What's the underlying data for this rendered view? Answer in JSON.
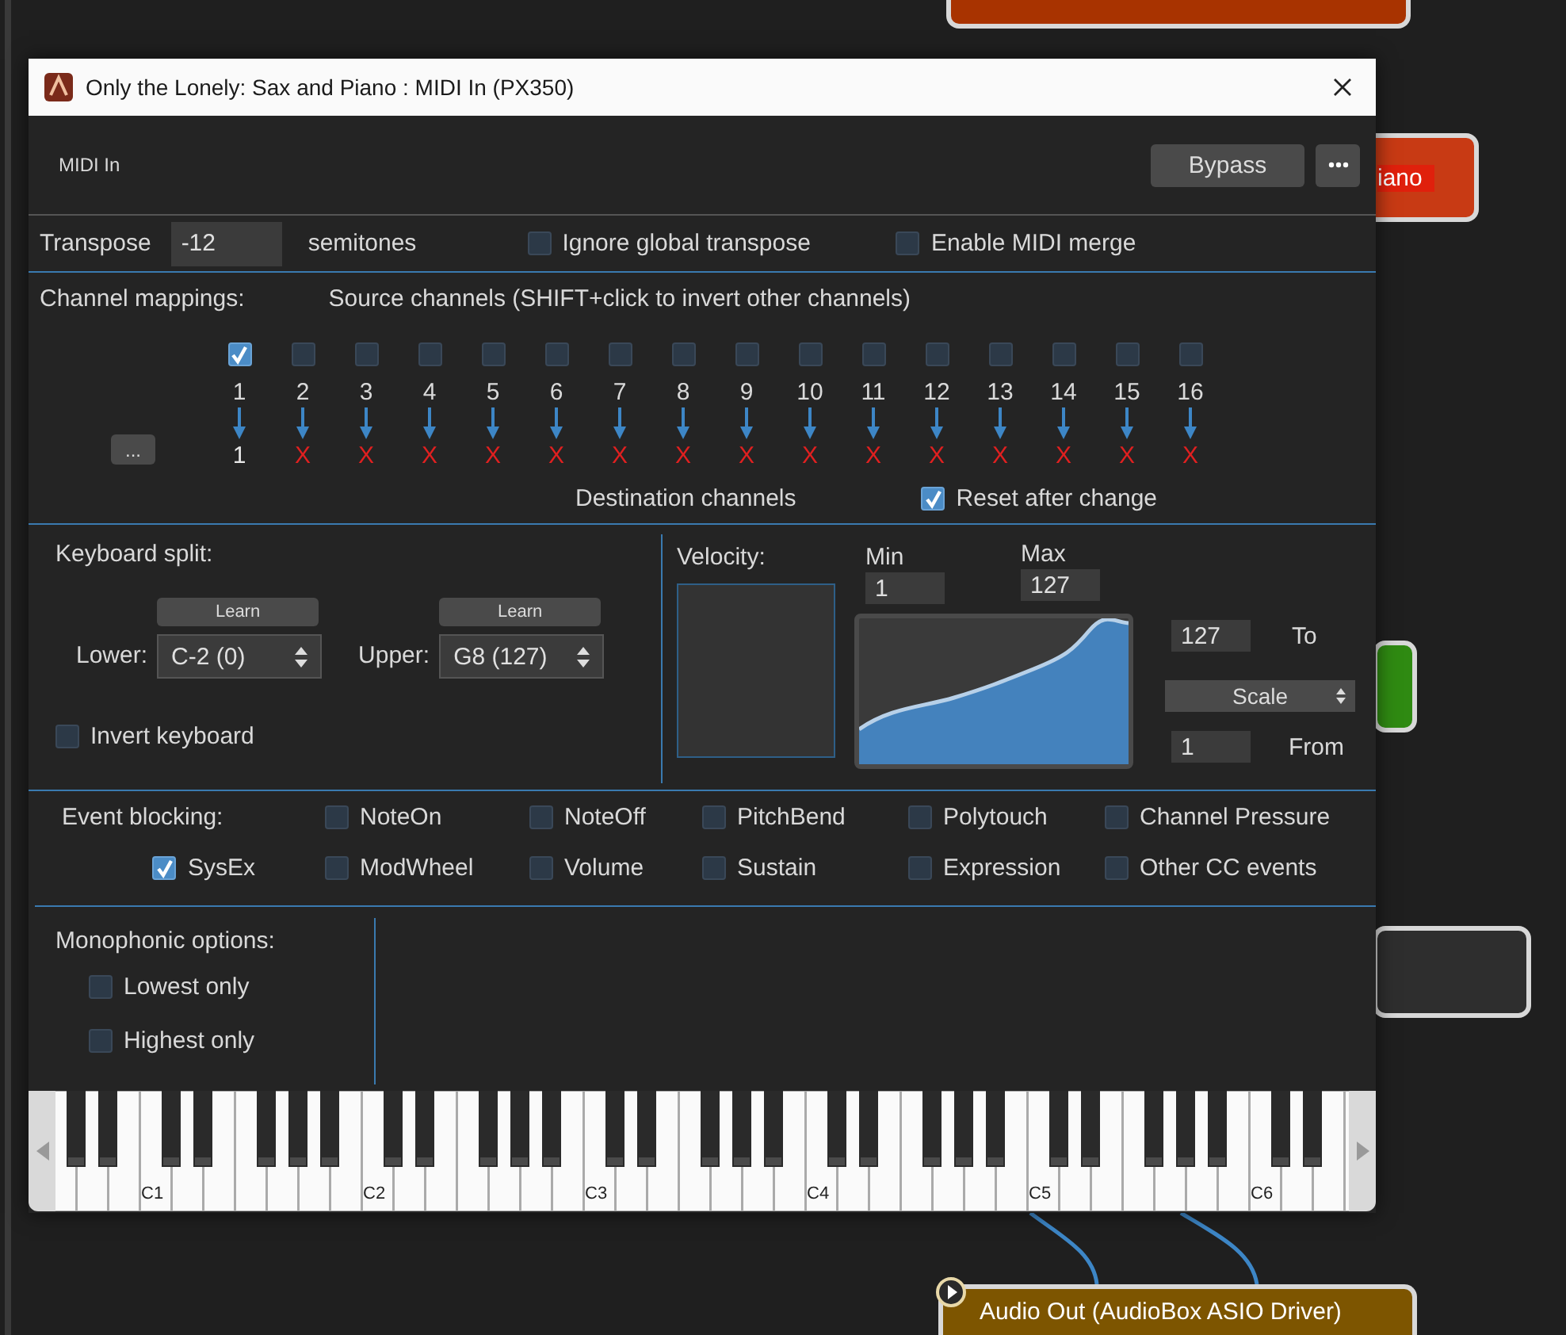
{
  "canvas": {
    "nodes": [
      {
        "color": "#a83300"
      },
      {
        "color": "#c83a14",
        "label": "iano"
      },
      {
        "color": "#2f8a12"
      },
      {
        "color": "#2e2e2e"
      },
      {
        "color": "#7d5500",
        "label": "Audio Out (AudioBox ASIO Driver)"
      }
    ]
  },
  "window": {
    "title": "Only the Lonely: Sax and Piano : MIDI In (PX350)"
  },
  "header": {
    "label": "MIDI In",
    "bypass": "Bypass"
  },
  "transpose": {
    "label": "Transpose",
    "value": "-12",
    "unit": "semitones",
    "options": [
      {
        "label": "Ignore global transpose",
        "checked": false
      },
      {
        "label": "Enable MIDI merge",
        "checked": false
      }
    ]
  },
  "channel_mappings": {
    "label": "Channel mappings:",
    "source_heading": "Source channels (SHIFT+click to invert other channels)",
    "more_button": "...",
    "destination_heading": "Destination channels",
    "reset": {
      "label": "Reset after change",
      "checked": true
    },
    "channels": [
      {
        "source": "1",
        "checked": true,
        "destination": "1",
        "mapped": true
      },
      {
        "source": "2",
        "checked": false,
        "destination": "X",
        "mapped": false
      },
      {
        "source": "3",
        "checked": false,
        "destination": "X",
        "mapped": false
      },
      {
        "source": "4",
        "checked": false,
        "destination": "X",
        "mapped": false
      },
      {
        "source": "5",
        "checked": false,
        "destination": "X",
        "mapped": false
      },
      {
        "source": "6",
        "checked": false,
        "destination": "X",
        "mapped": false
      },
      {
        "source": "7",
        "checked": false,
        "destination": "X",
        "mapped": false
      },
      {
        "source": "8",
        "checked": false,
        "destination": "X",
        "mapped": false
      },
      {
        "source": "9",
        "checked": false,
        "destination": "X",
        "mapped": false
      },
      {
        "source": "10",
        "checked": false,
        "destination": "X",
        "mapped": false
      },
      {
        "source": "11",
        "checked": false,
        "destination": "X",
        "mapped": false
      },
      {
        "source": "12",
        "checked": false,
        "destination": "X",
        "mapped": false
      },
      {
        "source": "13",
        "checked": false,
        "destination": "X",
        "mapped": false
      },
      {
        "source": "14",
        "checked": false,
        "destination": "X",
        "mapped": false
      },
      {
        "source": "15",
        "checked": false,
        "destination": "X",
        "mapped": false
      },
      {
        "source": "16",
        "checked": false,
        "destination": "X",
        "mapped": false
      }
    ]
  },
  "keyboard_split": {
    "label": "Keyboard split:",
    "ranges": [
      {
        "label": "Lower:",
        "learn": "Learn",
        "value": "C-2 (0)"
      },
      {
        "label": "Upper:",
        "learn": "Learn",
        "value": "G8 (127)"
      }
    ],
    "invert": {
      "label": "Invert keyboard",
      "checked": false
    }
  },
  "velocity": {
    "label": "Velocity:",
    "min_label": "Min",
    "min": "1",
    "max_label": "Max",
    "max": "127",
    "to": "127",
    "to_label": "To",
    "mode": "Scale",
    "from": "1",
    "from_label": "From"
  },
  "event_blocking": {
    "label": "Event blocking:",
    "events": [
      {
        "label": "NoteOn",
        "checked": false
      },
      {
        "label": "NoteOff",
        "checked": false
      },
      {
        "label": "PitchBend",
        "checked": false
      },
      {
        "label": "Polytouch",
        "checked": false
      },
      {
        "label": "Channel Pressure",
        "checked": false
      },
      {
        "label": "SysEx",
        "checked": true
      },
      {
        "label": "ModWheel",
        "checked": false
      },
      {
        "label": "Volume",
        "checked": false
      },
      {
        "label": "Sustain",
        "checked": false
      },
      {
        "label": "Expression",
        "checked": false
      },
      {
        "label": "Other CC events",
        "checked": false
      }
    ]
  },
  "monophonic": {
    "label": "Monophonic options:",
    "options": [
      {
        "label": "Lowest only",
        "checked": false
      },
      {
        "label": "Highest only",
        "checked": false
      }
    ]
  },
  "keyboard": {
    "octave_labels": [
      "C1",
      "C2",
      "C3",
      "C4",
      "C5",
      "C6"
    ]
  }
}
